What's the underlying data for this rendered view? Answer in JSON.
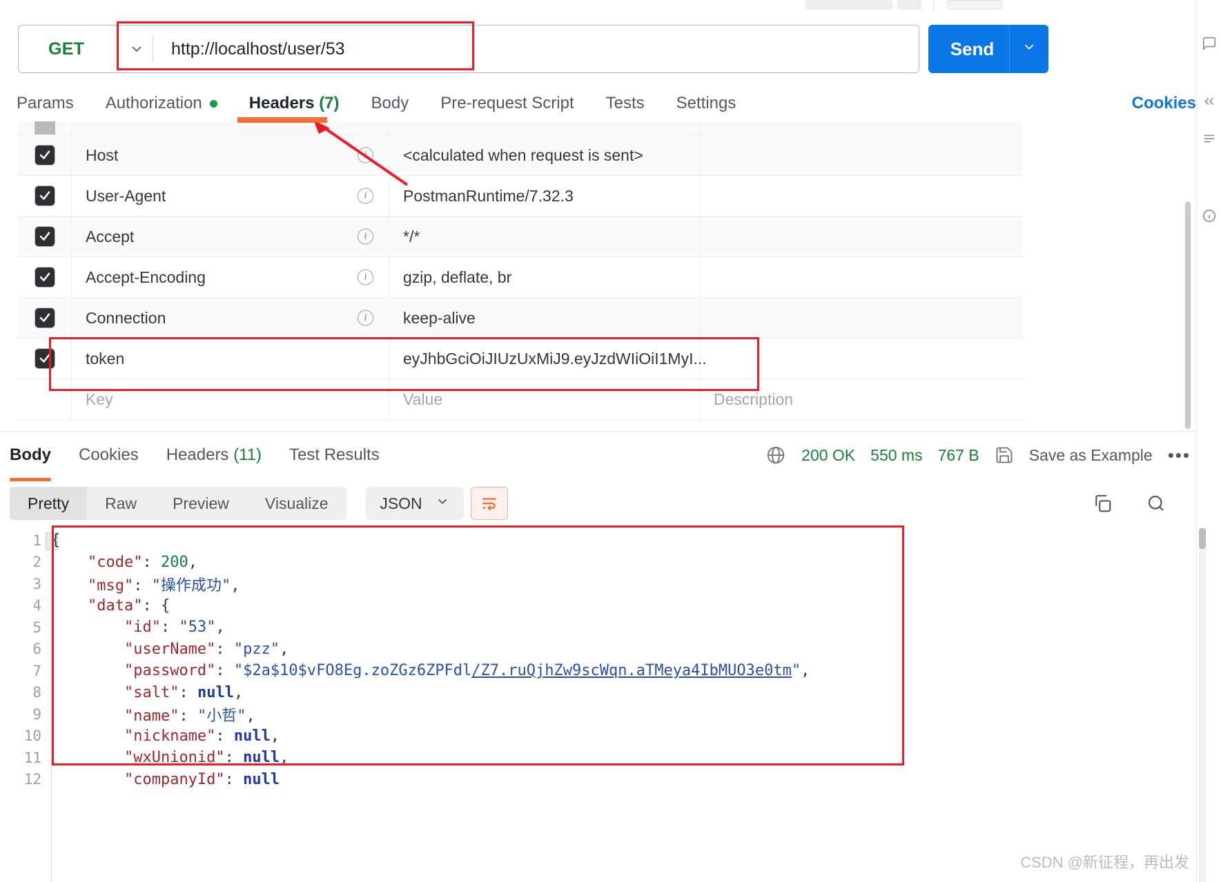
{
  "request": {
    "method": "GET",
    "method_caret": "chevron-down",
    "url": "http://localhost/user/53",
    "send_label": "Send",
    "cookies_label": "Cookies",
    "tabs": [
      {
        "label": "Params",
        "active": false,
        "dot": false,
        "count": ""
      },
      {
        "label": "Authorization",
        "active": false,
        "dot": true,
        "count": ""
      },
      {
        "label": "Headers",
        "active": true,
        "dot": false,
        "count": "(7)"
      },
      {
        "label": "Body",
        "active": false,
        "dot": false,
        "count": ""
      },
      {
        "label": "Pre-request Script",
        "active": false,
        "dot": false,
        "count": ""
      },
      {
        "label": "Tests",
        "active": false,
        "dot": false,
        "count": ""
      },
      {
        "label": "Settings",
        "active": false,
        "dot": false,
        "count": ""
      }
    ]
  },
  "headers_table": {
    "placeholders": {
      "key": "Key",
      "value": "Value",
      "description": "Description"
    },
    "rows": [
      {
        "checked": true,
        "key": "Host",
        "value": "<calculated when request is sent>",
        "info": true,
        "description": ""
      },
      {
        "checked": true,
        "key": "User-Agent",
        "value": "PostmanRuntime/7.32.3",
        "info": true,
        "description": ""
      },
      {
        "checked": true,
        "key": "Accept",
        "value": "*/*",
        "info": true,
        "description": ""
      },
      {
        "checked": true,
        "key": "Accept-Encoding",
        "value": "gzip, deflate, br",
        "info": true,
        "description": ""
      },
      {
        "checked": true,
        "key": "Connection",
        "value": "keep-alive",
        "info": true,
        "description": ""
      },
      {
        "checked": true,
        "key": "token",
        "value": "eyJhbGciOiJIUzUxMiJ9.eyJzdWIiOiI1MyI...",
        "info": false,
        "description": ""
      }
    ]
  },
  "response": {
    "tabs": [
      {
        "label": "Body",
        "active": true,
        "count": ""
      },
      {
        "label": "Cookies",
        "active": false,
        "count": ""
      },
      {
        "label": "Headers",
        "active": false,
        "count": "(11)"
      },
      {
        "label": "Test Results",
        "active": false,
        "count": ""
      }
    ],
    "status": "200 OK",
    "time": "550 ms",
    "size": "767 B",
    "save_as_example": "Save as Example",
    "more_label": "•••",
    "view_modes": [
      {
        "label": "Pretty",
        "active": true
      },
      {
        "label": "Raw",
        "active": false
      },
      {
        "label": "Preview",
        "active": false
      },
      {
        "label": "Visualize",
        "active": false
      }
    ],
    "language": "JSON",
    "language_caret": "chevron-down"
  },
  "body_code": {
    "lines": [
      {
        "num": "1",
        "segments": [
          {
            "t": "{",
            "c": "p"
          }
        ]
      },
      {
        "num": "2",
        "segments": [
          {
            "t": "    ",
            "c": "p"
          },
          {
            "t": "\"code\"",
            "c": "k"
          },
          {
            "t": ": ",
            "c": "p"
          },
          {
            "t": "200",
            "c": "n"
          },
          {
            "t": ",",
            "c": "p"
          }
        ]
      },
      {
        "num": "3",
        "segments": [
          {
            "t": "    ",
            "c": "p"
          },
          {
            "t": "\"msg\"",
            "c": "k"
          },
          {
            "t": ": ",
            "c": "p"
          },
          {
            "t": "\"操作成功\"",
            "c": "s"
          },
          {
            "t": ",",
            "c": "p"
          }
        ]
      },
      {
        "num": "4",
        "segments": [
          {
            "t": "    ",
            "c": "p"
          },
          {
            "t": "\"data\"",
            "c": "k"
          },
          {
            "t": ": {",
            "c": "p"
          }
        ]
      },
      {
        "num": "5",
        "segments": [
          {
            "t": "        ",
            "c": "p"
          },
          {
            "t": "\"id\"",
            "c": "k"
          },
          {
            "t": ": ",
            "c": "p"
          },
          {
            "t": "\"53\"",
            "c": "s"
          },
          {
            "t": ",",
            "c": "p"
          }
        ]
      },
      {
        "num": "6",
        "segments": [
          {
            "t": "        ",
            "c": "p"
          },
          {
            "t": "\"userName\"",
            "c": "k"
          },
          {
            "t": ": ",
            "c": "p"
          },
          {
            "t": "\"pzz\"",
            "c": "s"
          },
          {
            "t": ",",
            "c": "p"
          }
        ]
      },
      {
        "num": "7",
        "segments": [
          {
            "t": "        ",
            "c": "p"
          },
          {
            "t": "\"password\"",
            "c": "k"
          },
          {
            "t": ": ",
            "c": "p"
          },
          {
            "t": "\"$2a$10$vFO8Eg.zoZGz6ZPFdl",
            "c": "s"
          },
          {
            "t": "/Z7.ruQjhZw9scWqn.aTMeya4IbMUO3e0tm",
            "c": "su"
          },
          {
            "t": "\"",
            "c": "s"
          },
          {
            "t": ",",
            "c": "p"
          }
        ]
      },
      {
        "num": "8",
        "segments": [
          {
            "t": "        ",
            "c": "p"
          },
          {
            "t": "\"salt\"",
            "c": "k"
          },
          {
            "t": ": ",
            "c": "p"
          },
          {
            "t": "null",
            "c": "nl"
          },
          {
            "t": ",",
            "c": "p"
          }
        ]
      },
      {
        "num": "9",
        "segments": [
          {
            "t": "        ",
            "c": "p"
          },
          {
            "t": "\"name\"",
            "c": "k"
          },
          {
            "t": ": ",
            "c": "p"
          },
          {
            "t": "\"小哲\"",
            "c": "s"
          },
          {
            "t": ",",
            "c": "p"
          }
        ]
      },
      {
        "num": "10",
        "segments": [
          {
            "t": "        ",
            "c": "p"
          },
          {
            "t": "\"nickname\"",
            "c": "k"
          },
          {
            "t": ": ",
            "c": "p"
          },
          {
            "t": "null",
            "c": "nl"
          },
          {
            "t": ",",
            "c": "p"
          }
        ]
      },
      {
        "num": "11",
        "segments": [
          {
            "t": "        ",
            "c": "p"
          },
          {
            "t": "\"wxUnionid\"",
            "c": "k"
          },
          {
            "t": ": ",
            "c": "p"
          },
          {
            "t": "null",
            "c": "nl"
          },
          {
            "t": ",",
            "c": "p"
          }
        ]
      },
      {
        "num": "12",
        "segments": [
          {
            "t": "        ",
            "c": "p"
          },
          {
            "t": "\"companyId\"",
            "c": "k"
          },
          {
            "t": ": ",
            "c": "p"
          },
          {
            "t": "null",
            "c": "nl"
          }
        ]
      }
    ]
  },
  "watermark": "CSDN @新征程，再出发",
  "colors": {
    "accent_orange": "#f26b3a",
    "primary_blue": "#0b76e8",
    "success_green": "#1a7f37",
    "annotation_red": "#ee1b24"
  }
}
